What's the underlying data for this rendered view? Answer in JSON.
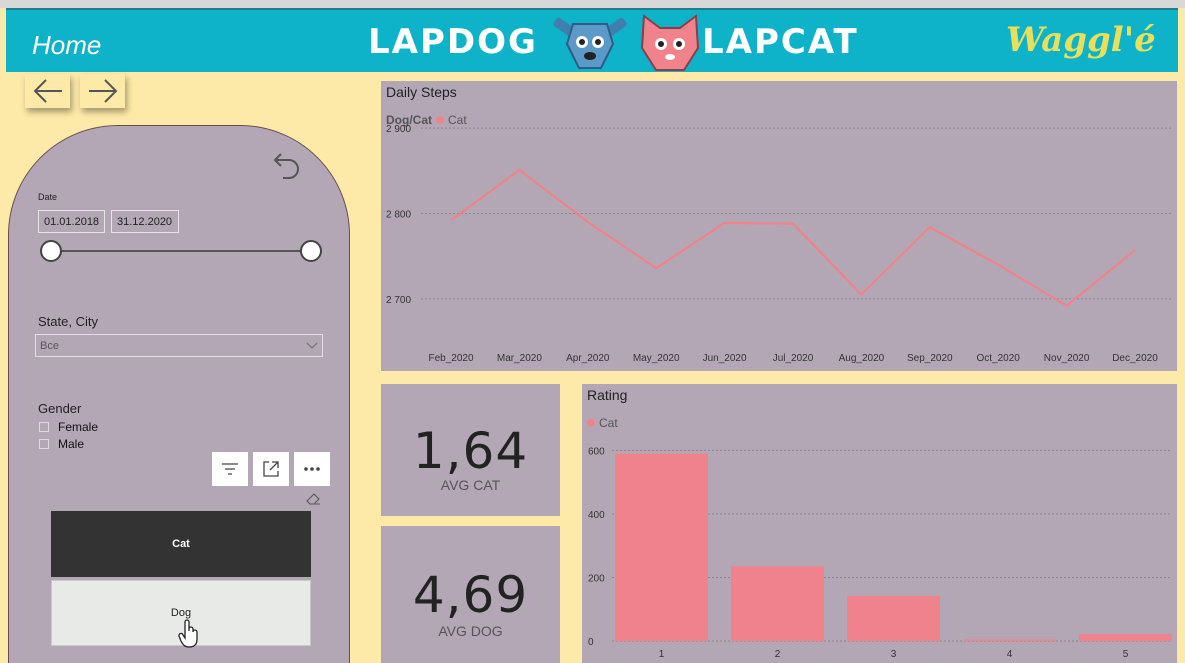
{
  "header": {
    "home_label": "Home",
    "brand_dog": "LAPDOG",
    "brand_cat": "LAPCAT",
    "waggle": "Waggl'é"
  },
  "nav": {
    "back_icon": "arrow-left-icon",
    "forward_icon": "arrow-right-icon"
  },
  "filters": {
    "reset_icon": "undo-icon",
    "date_label": "Date",
    "date_from": "01.01.2018",
    "date_to": "31.12.2020",
    "state_label": "State, City",
    "state_value": "Все",
    "gender_label": "Gender",
    "gender_options": [
      "Female",
      "Male"
    ],
    "type_options": [
      "Cat",
      "Dog"
    ],
    "selected_type": "Cat"
  },
  "daily_steps": {
    "title": "Daily Steps",
    "legend_title": "Dog/Cat",
    "legend_item": "Cat"
  },
  "kpis": [
    {
      "value": "1,64",
      "label": "AVG CAT"
    },
    {
      "value": "4,69",
      "label": "AVG DOG"
    }
  ],
  "rating": {
    "title": "Rating",
    "legend_item": "Cat"
  },
  "colors": {
    "header": "#0fb3c9",
    "background": "#fdeaa8",
    "panel": "#b3a7b6",
    "cat_series": "#f0828c",
    "selected_tile": "#333333"
  },
  "chart_data": [
    {
      "type": "line",
      "title": "Daily Steps",
      "x": [
        "Feb_2020",
        "Mar_2020",
        "Apr_2020",
        "May_2020",
        "Jun_2020",
        "Jul_2020",
        "Aug_2020",
        "Sep_2020",
        "Oct_2020",
        "Nov_2020",
        "Dec_2020"
      ],
      "series": [
        {
          "name": "Cat",
          "values": [
            2792,
            2851,
            2790,
            2736,
            2789,
            2788,
            2705,
            2784,
            2740,
            2692,
            2757
          ]
        }
      ],
      "yticks": [
        "2 700",
        "2 800",
        "2 900"
      ],
      "ylim": [
        2660,
        2920
      ],
      "grid": true,
      "legend": "top-left"
    },
    {
      "type": "bar",
      "title": "Rating",
      "categories": [
        "1",
        "2",
        "3",
        "4",
        "5"
      ],
      "series": [
        {
          "name": "Cat",
          "values": [
            590,
            235,
            142,
            5,
            22
          ]
        }
      ],
      "yticks": [
        "0",
        "200",
        "400",
        "600"
      ],
      "ylim": [
        0,
        620
      ],
      "grid": true,
      "legend": "top-left"
    }
  ]
}
